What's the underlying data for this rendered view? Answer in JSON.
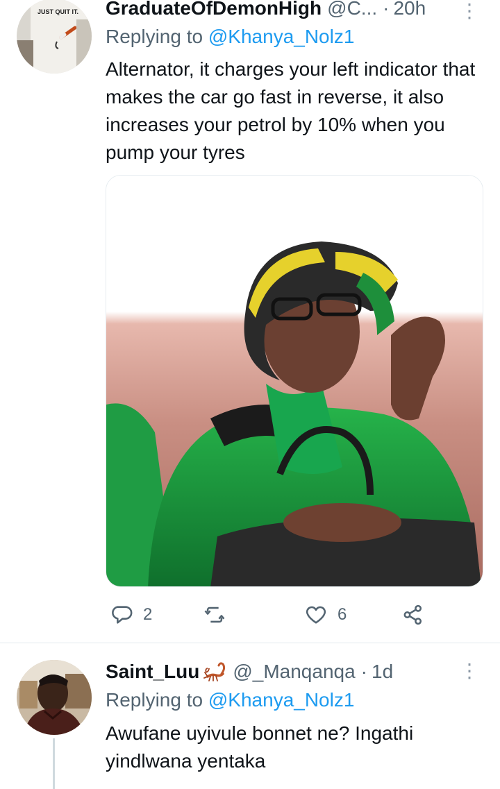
{
  "tweet1": {
    "display_name": "GraduateOfDemonHigh",
    "handle": "@C...",
    "time": "20h",
    "replying_prefix": "Replying to",
    "replying_to": "@Khanya_Nolz1",
    "text": "Alternator, it charges your left indicator that makes the car go fast in reverse, it also increases your petrol by 10% when you pump your tyres",
    "avatar_caption": "JUST QUIT IT.",
    "actions": {
      "reply_count": "2",
      "retweet_count": "",
      "like_count": "6"
    }
  },
  "tweet2": {
    "display_name": "Saint_Luu",
    "handle": "@_Manqanqa",
    "time": "1d",
    "replying_prefix": "Replying to",
    "replying_to": "@Khanya_Nolz1",
    "text": "Awufane uyivule bonnet ne? Ingathi yindlwana yentaka"
  },
  "colors": {
    "text": "#0f1419",
    "secondary": "#536471",
    "link": "#1d9bf0",
    "divider": "#e1e8ed"
  },
  "icons": {
    "reply": "reply-icon",
    "retweet": "retweet-icon",
    "like": "heart-icon",
    "share": "share-icon",
    "more": "more-icon",
    "emoji": "scorpion-emoji"
  }
}
